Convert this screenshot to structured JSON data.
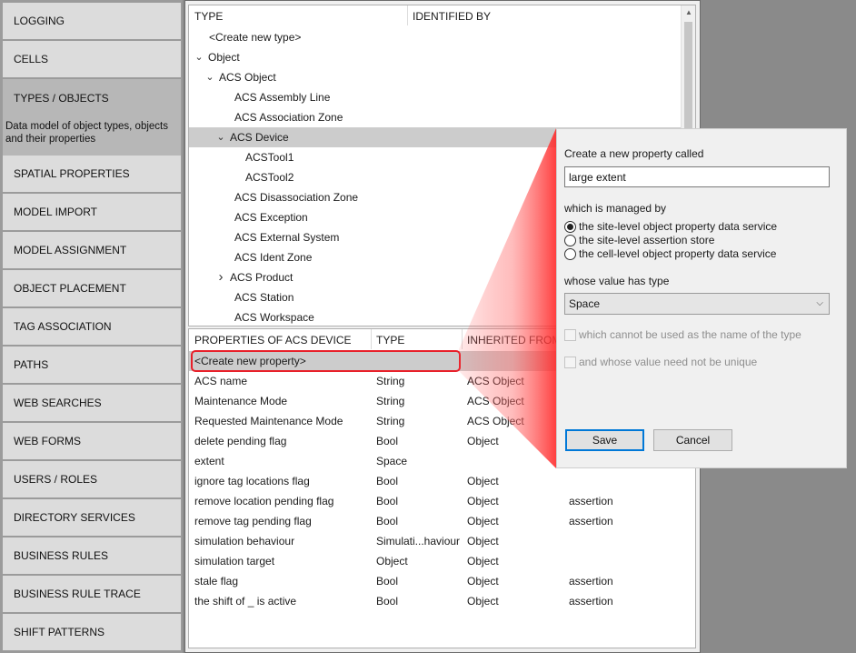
{
  "nav": {
    "items": [
      {
        "label": "LOGGING"
      },
      {
        "label": "CELLS"
      },
      {
        "label": "TYPES / OBJECTS",
        "active": true,
        "description": "Data model of object types, objects and their properties"
      },
      {
        "label": "SPATIAL PROPERTIES"
      },
      {
        "label": "MODEL IMPORT"
      },
      {
        "label": "MODEL ASSIGNMENT"
      },
      {
        "label": "OBJECT PLACEMENT"
      },
      {
        "label": "TAG ASSOCIATION"
      },
      {
        "label": "PATHS"
      },
      {
        "label": "WEB SEARCHES"
      },
      {
        "label": "WEB FORMS"
      },
      {
        "label": "USERS / ROLES"
      },
      {
        "label": "DIRECTORY SERVICES"
      },
      {
        "label": "BUSINESS RULES"
      },
      {
        "label": "BUSINESS RULE TRACE"
      },
      {
        "label": "SHIFT PATTERNS"
      }
    ]
  },
  "type_tree": {
    "headers": {
      "type": "TYPE",
      "identified_by": "IDENTIFIED BY"
    },
    "rows": [
      {
        "label": "<Create new type>",
        "indent": 0,
        "chevron": ""
      },
      {
        "label": "Object",
        "indent": 0,
        "chevron": "down"
      },
      {
        "label": "ACS Object",
        "indent": 1,
        "chevron": "down"
      },
      {
        "label": "ACS Assembly Line",
        "indent": 2,
        "chevron": ""
      },
      {
        "label": "ACS Association Zone",
        "indent": 2,
        "chevron": ""
      },
      {
        "label": "ACS Device",
        "indent": 2,
        "chevron": "down",
        "selected": true
      },
      {
        "label": "ACSTool1",
        "indent": 3,
        "chevron": ""
      },
      {
        "label": "ACSTool2",
        "indent": 3,
        "chevron": ""
      },
      {
        "label": "ACS Disassociation Zone",
        "indent": 2,
        "chevron": ""
      },
      {
        "label": "ACS Exception",
        "indent": 2,
        "chevron": ""
      },
      {
        "label": "ACS External System",
        "indent": 2,
        "chevron": ""
      },
      {
        "label": "ACS Ident Zone",
        "indent": 2,
        "chevron": ""
      },
      {
        "label": "ACS Product",
        "indent": 2,
        "chevron": "right"
      },
      {
        "label": "ACS Station",
        "indent": 2,
        "chevron": ""
      },
      {
        "label": "ACS Workspace",
        "indent": 2,
        "chevron": ""
      }
    ]
  },
  "properties": {
    "headers": {
      "name": "PROPERTIES OF ACS DEVICE",
      "type": "TYPE",
      "inherited": "INHERITED FROM"
    },
    "create_label": "<Create new property>",
    "rows": [
      {
        "name": "ACS name",
        "type": "String",
        "inherited": "ACS Object",
        "source": ""
      },
      {
        "name": "Maintenance Mode",
        "type": "String",
        "inherited": "ACS Object",
        "source": ""
      },
      {
        "name": "Requested Maintenance Mode",
        "type": "String",
        "inherited": "ACS Object",
        "source": ""
      },
      {
        "name": "delete pending flag",
        "type": "Bool",
        "inherited": "Object",
        "source": ""
      },
      {
        "name": "extent",
        "type": "Space",
        "inherited": "",
        "source": ""
      },
      {
        "name": "ignore tag locations flag",
        "type": "Bool",
        "inherited": "Object",
        "source": ""
      },
      {
        "name": "remove location pending flag",
        "type": "Bool",
        "inherited": "Object",
        "source": "assertion"
      },
      {
        "name": "remove tag pending flag",
        "type": "Bool",
        "inherited": "Object",
        "source": "assertion"
      },
      {
        "name": "simulation behaviour",
        "type": "Simulati...haviour",
        "inherited": "Object",
        "source": ""
      },
      {
        "name": "simulation target",
        "type": "Object",
        "inherited": "Object",
        "source": ""
      },
      {
        "name": "stale flag",
        "type": "Bool",
        "inherited": "Object",
        "source": "assertion"
      },
      {
        "name": "the shift of _ is active",
        "type": "Bool",
        "inherited": "Object",
        "source": "assertion"
      }
    ]
  },
  "dialog": {
    "create_label": "Create a new property called",
    "name_value": "large extent",
    "managed_label": "which is managed by",
    "managed_options": [
      {
        "label": "the site-level object property data service",
        "checked": true
      },
      {
        "label": "the site-level assertion store",
        "checked": false
      },
      {
        "label": "the cell-level object property data service",
        "checked": false
      }
    ],
    "type_label": "whose value has type",
    "type_value": "Space",
    "check_not_name": "which cannot be used as the name of the type",
    "check_not_unique": "and whose value need not be unique",
    "save_label": "Save",
    "cancel_label": "Cancel"
  },
  "colors": {
    "highlight": "#e8202a",
    "selected_row": "#cccccc",
    "nav_active": "#b7b7b7"
  }
}
